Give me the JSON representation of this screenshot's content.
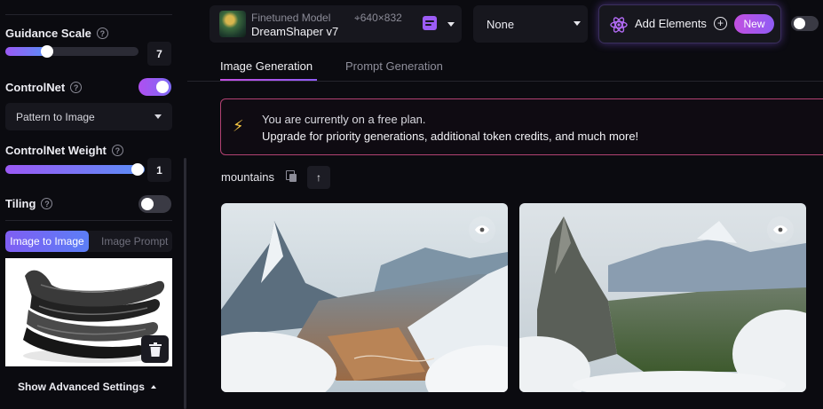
{
  "sidebar": {
    "guidance": {
      "label": "Guidance Scale",
      "value": "7",
      "fill_fraction": 0.27
    },
    "controlnet": {
      "label": "ControlNet",
      "enabled": true,
      "select_value": "Pattern to Image"
    },
    "controlnet_weight": {
      "label": "ControlNet Weight",
      "value": "1",
      "fill_fraction": 1.0
    },
    "tiling": {
      "label": "Tiling",
      "enabled": false
    },
    "mode_tabs": {
      "active": "Image to Image",
      "inactive": "Image Prompt"
    },
    "advanced_label": "Show Advanced Settings",
    "help_glyph": "?"
  },
  "topbar": {
    "model": {
      "sublabel": "Finetuned Model",
      "name": "DreamShaper v7",
      "dims": "⌖640×832"
    },
    "style_select": "None",
    "add_elements": {
      "label": "Add Elements",
      "plus": "+",
      "badge": "New"
    },
    "toggle_enabled": false
  },
  "tabs": {
    "active": "Image Generation",
    "inactive": "Prompt Generation"
  },
  "banner": {
    "icon": "⚡",
    "line1": "You are currently on a free plan.",
    "line2": "Upgrade for priority generations, additional token credits, and much more!"
  },
  "prompt": {
    "text": "mountains",
    "reuse_glyph": "↑"
  },
  "colors": {
    "accent_purple": "#9b59f5",
    "accent_pink": "#c24fe0",
    "banner_border": "#b24272"
  }
}
